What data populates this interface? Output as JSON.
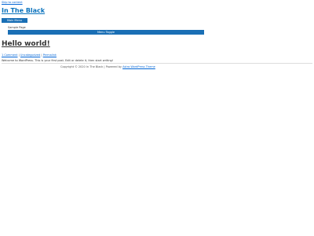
{
  "skip_link": "Skip to content",
  "header": {
    "site_title": "In The Black",
    "main_menu_label": "Main Menu"
  },
  "nav": {
    "sample_page": "Sample Page",
    "menu_toggle": "Menu Toggle"
  },
  "post": {
    "title": "Hello world!",
    "meta": {
      "comments": "1 Comment",
      "sep1": " | ",
      "category": "Uncategorized",
      "sep2": " | ",
      "permalink": "Permalink"
    },
    "content": "Welcome to WordPress. This is your first post. Edit or delete it, then start writing!"
  },
  "footer": {
    "copyright": "Copyright © 2020 In The Black | Powered by ",
    "theme_link": "Astra WordPress Theme"
  }
}
